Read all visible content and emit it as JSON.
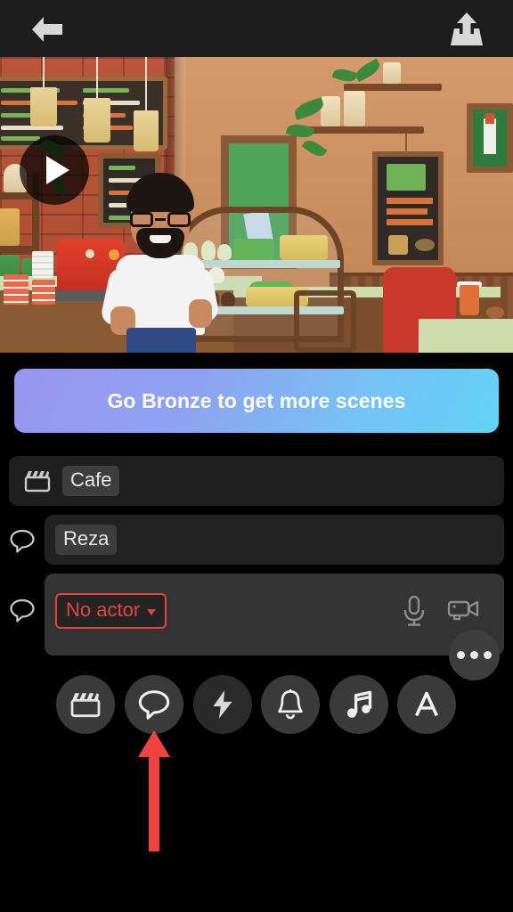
{
  "app": {
    "screen_title": "Scene editor",
    "background_color": "#000000"
  },
  "topbar": {
    "back_label": "Back",
    "back_icon": "arrow-left-icon",
    "share_label": "Share",
    "share_icon": "share-upload-icon"
  },
  "preview": {
    "scene_description": "3D animated cafe scene with bearded character in white t-shirt behind counter",
    "play_label": "Play",
    "play_icon": "play-triangle-icon"
  },
  "banner": {
    "label": "Go Bronze to get more scenes",
    "gradient_start": "#9a95f0",
    "gradient_end": "#62d3f7",
    "text_color": "#ffffff"
  },
  "rows": {
    "scene": {
      "icon": "clapperboard-icon",
      "value": "Cafe"
    },
    "character": {
      "icon": "speech-bubble-icon",
      "value": "Reza"
    },
    "dialogue": {
      "icon": "speech-bubble-icon",
      "actor_value": "No actor",
      "actor_caret": "chevron-down-icon",
      "actor_color": "#e0463c",
      "mic_icon": "microphone-icon",
      "camera_icon": "video-camera-icon",
      "more_icon": "more-horizontal-icon",
      "more_label": "More"
    }
  },
  "toolbar": {
    "items": [
      {
        "name": "scene",
        "label": "Scene",
        "icon": "clapperboard-icon",
        "dim": false
      },
      {
        "name": "dialogue",
        "label": "Dialogue",
        "icon": "speech-bubble-icon",
        "dim": false
      },
      {
        "name": "action",
        "label": "Action",
        "icon": "lightning-bolt-icon",
        "dim": true
      },
      {
        "name": "effects",
        "label": "Effects",
        "icon": "bell-icon",
        "dim": false
      },
      {
        "name": "music",
        "label": "Music",
        "icon": "music-note-icon",
        "dim": false
      },
      {
        "name": "text",
        "label": "Text",
        "icon": "letter-a-icon",
        "dim": false
      }
    ]
  },
  "annotation": {
    "arrow_color": "#ee4340",
    "arrow_points_to": "Dialogue toolbar button"
  }
}
